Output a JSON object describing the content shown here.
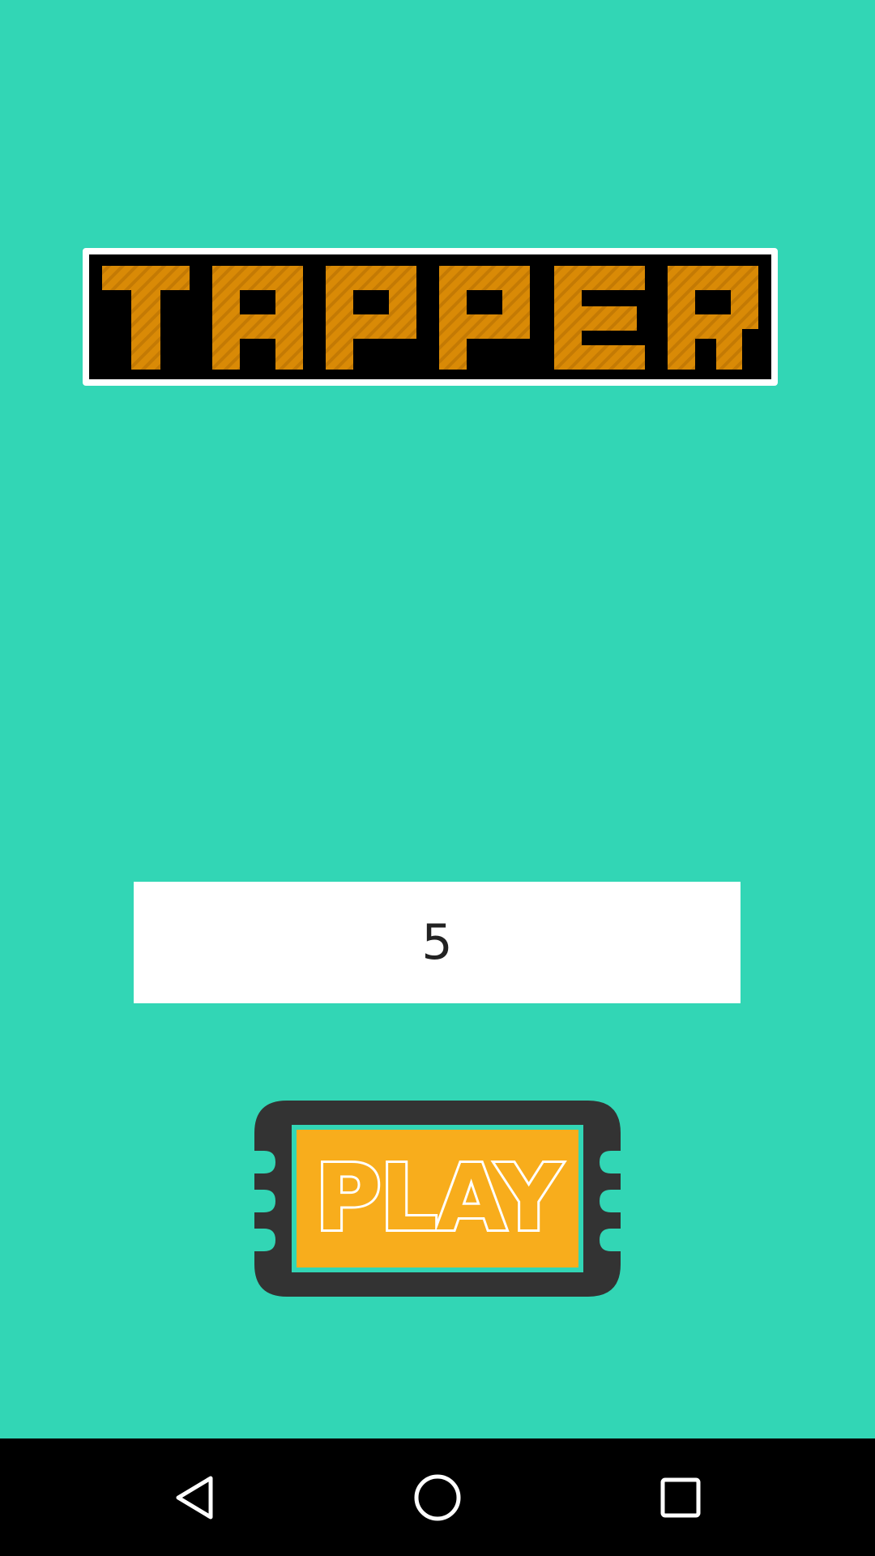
{
  "app": {
    "title": "TAPPER"
  },
  "count_input": {
    "value": "5"
  },
  "play_button": {
    "label": "PLAY"
  },
  "nav": {
    "back_icon": "back-triangle",
    "home_icon": "home-circle",
    "recent_icon": "recents-square"
  },
  "colors": {
    "background": "#32d6b5",
    "logo_fill": "#d98a06",
    "play_fill": "#f8ad1c",
    "play_frame": "#333333",
    "nav_bar": "#000000"
  }
}
